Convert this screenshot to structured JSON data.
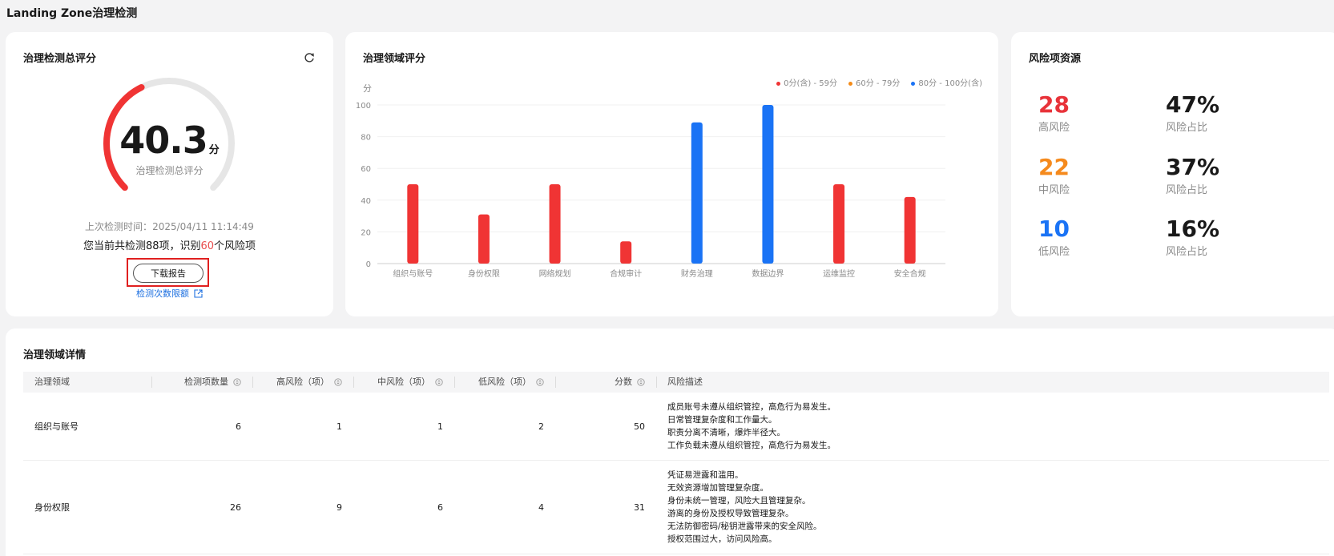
{
  "page_title": "Landing Zone治理检测",
  "score_card": {
    "title": "治理检测总评分",
    "score": "40.3",
    "score_fraction": 0.403,
    "unit": "分",
    "score_label": "治理检测总评分",
    "last_time_label": "上次检测时间：",
    "last_time": "2025/04/11 11:14:49",
    "summary_prefix": "您当前共检测88项，识别",
    "summary_count": "60",
    "summary_suffix": "个风险项",
    "download_btn": "下载报告",
    "quota_link": "检测次数限额"
  },
  "domain_card": {
    "title": "治理领域评分",
    "legend": [
      {
        "label": "0分(含) - 59分",
        "color": "#f03434"
      },
      {
        "label": "60分 - 79分",
        "color": "#f48b18"
      },
      {
        "label": "80分 - 100分(含)",
        "color": "#1a73f5"
      }
    ]
  },
  "chart_data": {
    "type": "bar",
    "ylabel": "分",
    "ylim": [
      0,
      100
    ],
    "yticks": [
      0,
      20,
      40,
      60,
      80,
      100
    ],
    "categories": [
      "组织与账号",
      "身份权限",
      "网络规划",
      "合规审计",
      "财务治理",
      "数据边界",
      "运维监控",
      "安全合规"
    ],
    "values": [
      50,
      31,
      50,
      14,
      89,
      100,
      50,
      42
    ],
    "grid": true,
    "legend_position": "top-right"
  },
  "risk_card": {
    "title": "风险项资源",
    "items": [
      {
        "count": "28",
        "label": "高风险",
        "pct": "47%",
        "pct_label": "风险占比",
        "color": "#e8333a"
      },
      {
        "count": "22",
        "label": "中风险",
        "pct": "37%",
        "pct_label": "风险占比",
        "color": "#f58a1d"
      },
      {
        "count": "10",
        "label": "低风险",
        "pct": "16%",
        "pct_label": "风险占比",
        "color": "#1a73f5"
      }
    ]
  },
  "detail": {
    "title": "治理领域详情",
    "columns": [
      "治理领域",
      "检测项数量",
      "高风险（项）",
      "中风险（项）",
      "低风险（项）",
      "分数",
      "风险描述"
    ],
    "rows": [
      {
        "domain": "组织与账号",
        "checks": "6",
        "high": "1",
        "mid": "1",
        "low": "2",
        "score": "50",
        "desc": [
          "成员账号未遵从组织管控，高危行为易发生。",
          "日常管理复杂度和工作量大。",
          "职责分离不清晰，爆炸半径大。",
          "工作负载未遵从组织管控，高危行为易发生。"
        ]
      },
      {
        "domain": "身份权限",
        "checks": "26",
        "high": "9",
        "mid": "6",
        "low": "4",
        "score": "31",
        "desc": [
          "凭证易泄露和滥用。",
          "无效资源增加管理复杂度。",
          "身份未统一管理，风险大且管理复杂。",
          "游离的身份及授权导致管理复杂。",
          "无法防御密码/秘钥泄露带来的安全风险。",
          "授权范围过大，访问风险高。"
        ]
      }
    ]
  }
}
